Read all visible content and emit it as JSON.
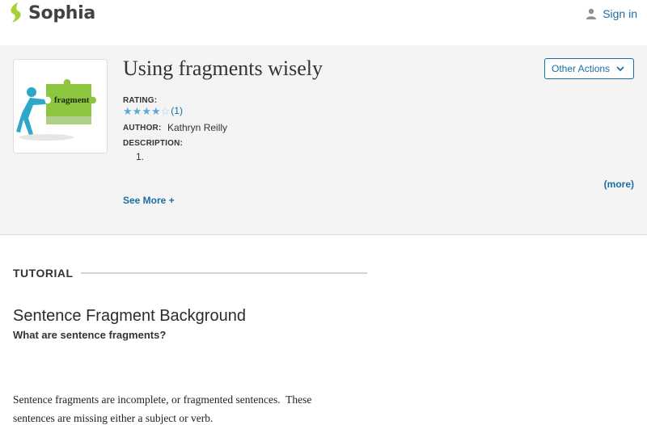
{
  "header": {
    "brand": "Sophia",
    "sign_in_label": "Sign in",
    "logo_color": "#a6cf38"
  },
  "lesson": {
    "title": "Using fragments wisely",
    "thumbnail_text": "fragment",
    "rating_label": "RATING:",
    "rating_stars": 4,
    "rating_max": 5,
    "rating_count": "(1)",
    "author_label": "AUTHOR:",
    "author_name": "Kathryn Reilly",
    "description_label": "DESCRIPTION:",
    "description_items": [
      "1."
    ],
    "more_label": "(more)",
    "see_more_label": "See More +",
    "other_actions_label": "Other Actions"
  },
  "tutorial": {
    "label": "TUTORIAL",
    "section_title": "Sentence Fragment Background",
    "section_subtitle": "What are sentence fragments?",
    "body_lines": [
      "Sentence fragments are incomplete, or fragmented sentences.  These",
      "sentences are missing either a subject or verb."
    ]
  },
  "colors": {
    "link": "#1a6ea2",
    "star": "#5da9d6",
    "hero_bg": "#f4f4f4",
    "puzzle_green": "#8cc63f"
  }
}
